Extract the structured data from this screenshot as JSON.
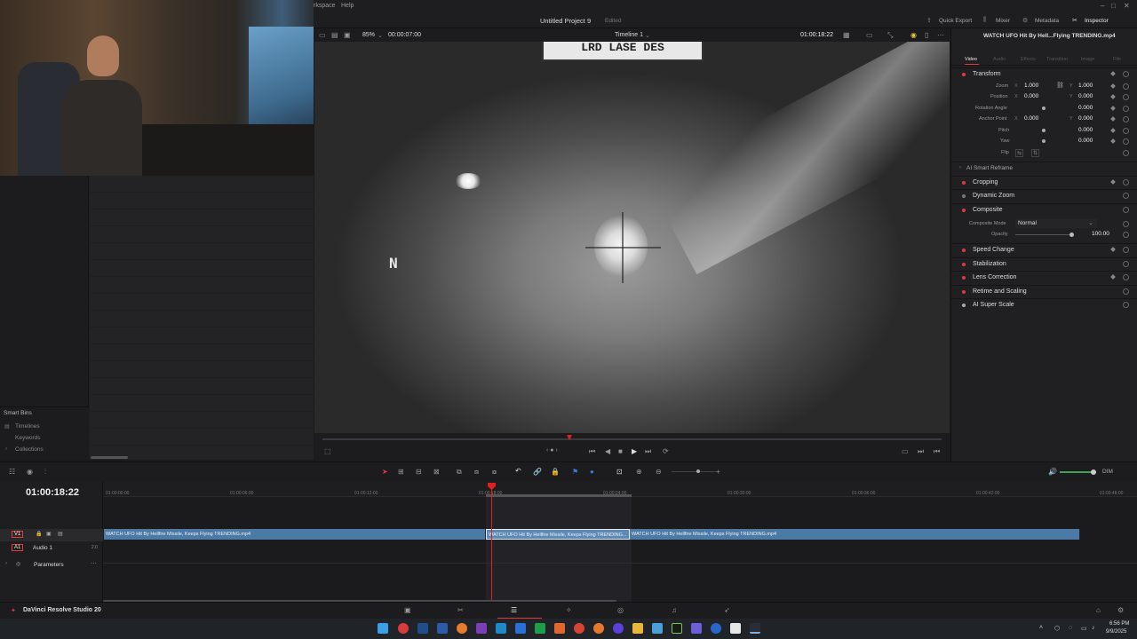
{
  "menubar": {
    "workspace": "rkspace",
    "help": "Help"
  },
  "title": {
    "project": "Untitled Project 9",
    "status": "Edited"
  },
  "header_tabs": {
    "quick_export": "Quick Export",
    "mixer": "Mixer",
    "metadata": "Metadata",
    "inspector": "Inspector"
  },
  "viewer": {
    "zoom": "85%",
    "duration": "00:00:07:00",
    "timeline_name": "Timeline 1",
    "timecode": "01:00:18:22",
    "overlay_text": "LRD LASE DES",
    "letter": "N"
  },
  "inspector": {
    "clip_name": "WATCH UFO Hit By Hell...Flying  TRENDING.mp4",
    "tabs": [
      "Video",
      "Audio",
      "Effects",
      "Transition",
      "Image",
      "File"
    ],
    "transform": {
      "title": "Transform",
      "zoom_label": "Zoom",
      "zoom_x": "1.000",
      "zoom_y": "1.000",
      "position_label": "Position",
      "position_x": "0.000",
      "position_y": "0.000",
      "rotation_label": "Rotation Angle",
      "rotation": "0.000",
      "anchor_label": "Anchor Point",
      "anchor_x": "0.000",
      "anchor_y": "0.000",
      "pitch_label": "Pitch",
      "pitch": "0.000",
      "yaw_label": "Yaw",
      "yaw": "0.000",
      "flip_label": "Flip"
    },
    "ai_smart_reframe": "AI Smart Reframe",
    "cropping": "Cropping",
    "dynamic_zoom": "Dynamic Zoom",
    "composite": {
      "title": "Composite",
      "mode_label": "Composite Mode",
      "mode_value": "Normal",
      "opacity_label": "Opacity",
      "opacity_value": "100.00"
    },
    "speed_change": "Speed Change",
    "stabilization": "Stabilization",
    "lens_correction": "Lens Correction",
    "retime_scaling": "Retime and Scaling",
    "ai_super_scale": "AI Super Scale"
  },
  "media": {
    "smart_bins": "Smart Bins",
    "timelines": "Timelines",
    "keywords": "Keywords",
    "collections": "Collections"
  },
  "timeline": {
    "timecode": "01:00:18:22",
    "ticks": [
      "01:00:00:00",
      "01:00:06:00",
      "01:00:12:00",
      "01:00:18:00",
      "01:00:24:00",
      "01:00:30:00",
      "01:00:36:00",
      "01:00:42:00",
      "01:00:48:00"
    ],
    "v1": "V1",
    "a1": "A1",
    "audio1": "Audio 1",
    "audio_level": "2.0",
    "parameters": "Parameters",
    "clip1": "WATCH UFO Hit By Hellfire Missile, Keeps Flying  TRENDING.mp4",
    "clip2": "WATCH UFO Hit By Hellfire Missile, Keeps Flying  TRENDING...",
    "clip3": "WATCH UFO Hit By Hellfire Missile, Keeps Flying  TRENDING.mp4"
  },
  "audio_meter": {
    "dim": "DIM"
  },
  "app": {
    "name": "DaVinci Resolve Studio 20"
  },
  "clock": {
    "time": "6:56 PM",
    "date": "9/9/2025"
  },
  "colors": {
    "accent_red": "#e23a3a",
    "clip_blue": "#4c7aa6",
    "playhead": "#e02020"
  }
}
